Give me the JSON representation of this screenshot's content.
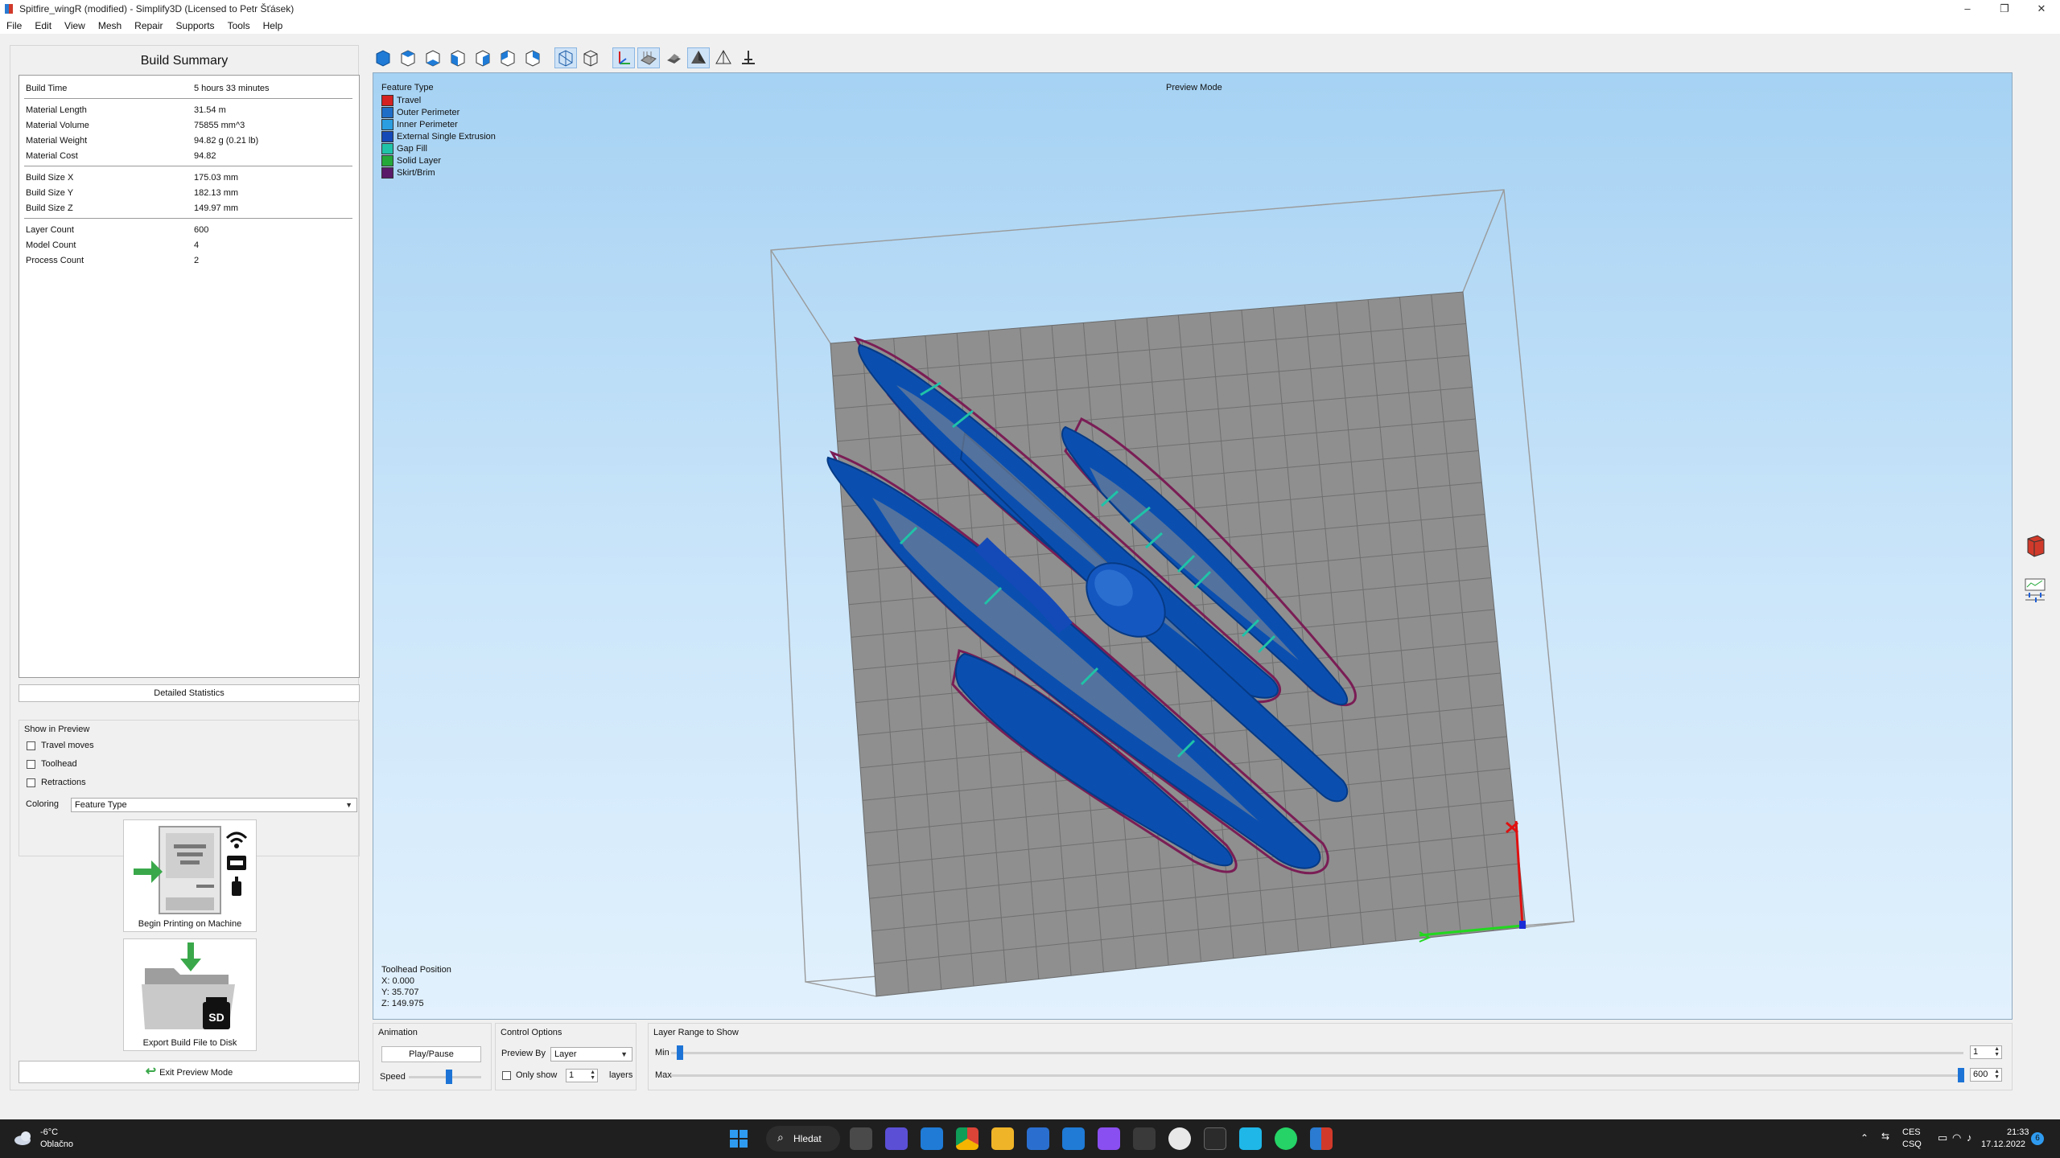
{
  "window": {
    "title": "Spitfire_wingR (modified) - Simplify3D (Licensed to Petr Šťásek)",
    "minimize_glyph": "–",
    "maximize_glyph": "❐",
    "close_glyph": "✕"
  },
  "menu": [
    "File",
    "Edit",
    "View",
    "Mesh",
    "Repair",
    "Supports",
    "Tools",
    "Help"
  ],
  "build_summary": {
    "title": "Build Summary",
    "stats": [
      {
        "key": "Build Time",
        "value": "5 hours 33 minutes"
      },
      {
        "key": "Material Length",
        "value": "31.54 m"
      },
      {
        "key": "Material Volume",
        "value": "75855 mm^3"
      },
      {
        "key": "Material Weight",
        "value": "94.82 g (0.21 lb)"
      },
      {
        "key": "Material Cost",
        "value": "94.82"
      },
      {
        "key": "Build Size X",
        "value": "175.03 mm"
      },
      {
        "key": "Build Size Y",
        "value": "182.13 mm"
      },
      {
        "key": "Build Size Z",
        "value": "149.97 mm"
      },
      {
        "key": "Layer Count",
        "value": "600"
      },
      {
        "key": "Model Count",
        "value": "4"
      },
      {
        "key": "Process Count",
        "value": "2"
      }
    ],
    "detailed_button": "Detailed Statistics"
  },
  "show_in_preview": {
    "title": "Show in Preview",
    "options": [
      {
        "label": "Travel moves",
        "checked": false
      },
      {
        "label": "Toolhead",
        "checked": false
      },
      {
        "label": "Retractions",
        "checked": false
      }
    ],
    "coloring_label": "Coloring",
    "coloring_value": "Feature Type"
  },
  "actions": {
    "begin_printing": "Begin Printing on Machine",
    "export": "Export Build File to Disk",
    "sd_label": "SD",
    "exit_preview": "Exit Preview Mode"
  },
  "toolbar_icons": [
    "view-default-icon",
    "view-top-icon",
    "view-bottom-icon",
    "view-front-icon",
    "view-back-icon",
    "view-left-icon",
    "view-right-icon",
    "wireframe-icon",
    "perspective-icon",
    "axes-icon",
    "build-plate-icon",
    "shadow-icon",
    "solid-view-icon",
    "section-icon",
    "origin-icon"
  ],
  "viewport": {
    "mode": "Preview Mode",
    "legend_title": "Feature Type",
    "legend": [
      {
        "label": "Travel",
        "color": "#d42121"
      },
      {
        "label": "Outer Perimeter",
        "color": "#1e6ec8"
      },
      {
        "label": "Inner Perimeter",
        "color": "#2a9ee0"
      },
      {
        "label": "External Single Extrusion",
        "color": "#1449b8"
      },
      {
        "label": "Gap Fill",
        "color": "#1fc3a8"
      },
      {
        "label": "Solid Layer",
        "color": "#25a83a"
      },
      {
        "label": "Skirt/Brim",
        "color": "#5a1a6a"
      }
    ],
    "toolhead_title": "Toolhead Position",
    "toolhead_x": "X: 0.000",
    "toolhead_y": "Y: 35.707",
    "toolhead_z": "Z: 149.975",
    "model_color": "#0a4fb0",
    "bed_color": "#8f8f8f"
  },
  "animation": {
    "title": "Animation",
    "play": "Play/Pause",
    "speed_label": "Speed",
    "speed_level": 0.55
  },
  "control_options": {
    "title": "Control Options",
    "preview_by_label": "Preview By",
    "preview_by_value": "Layer",
    "only_show_label": "Only show",
    "only_show_value": "1",
    "layers_label": "layers"
  },
  "layer_range": {
    "title": "Layer Range to Show",
    "min_label": "Min",
    "min_value": "1",
    "max_label": "Max",
    "max_value": "600"
  },
  "taskbar": {
    "temperature": "-6°C",
    "weather": "Oblačno",
    "search": "Hledat",
    "lang1": "CES",
    "lang2": "CSQ",
    "time": "21:33",
    "date": "17.12.2022",
    "notif_count": "6"
  }
}
